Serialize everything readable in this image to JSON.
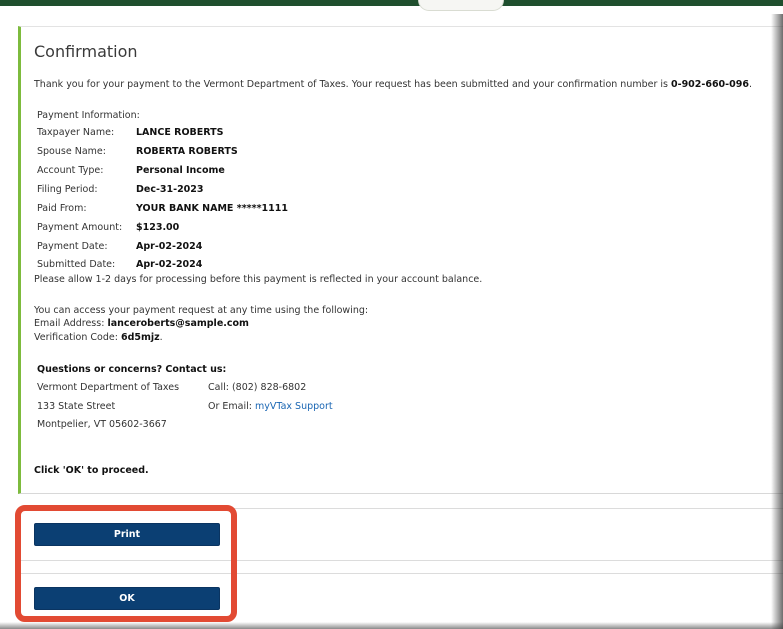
{
  "header": {
    "title": "Confirmation"
  },
  "message": {
    "intro": "Thank you for your payment to the Vermont Department of Taxes. Your request has been submitted and your confirmation number is ",
    "confirmation_number": "0-902-660-096",
    "period": "."
  },
  "payment": {
    "heading": "Payment Information:",
    "rows": [
      {
        "label": "Taxpayer Name:",
        "value": "LANCE ROBERTS"
      },
      {
        "label": "Spouse Name:",
        "value": "ROBERTA ROBERTS"
      },
      {
        "label": "Account Type:",
        "value": "Personal Income"
      },
      {
        "label": "Filing Period:",
        "value": "Dec-31-2023"
      },
      {
        "label": "Paid From:",
        "value": "YOUR BANK NAME *****1111"
      },
      {
        "label": "Payment Amount:",
        "value": "$123.00"
      },
      {
        "label": "Payment Date:",
        "value": "Apr-02-2024"
      },
      {
        "label": "Submitted Date:",
        "value": "Apr-02-2024"
      }
    ]
  },
  "notice": "Please allow 1-2 days for processing before this payment is reflected in your account balance.",
  "access": {
    "line": "You can access your payment request at any time using the following:",
    "email_label": "Email Address:",
    "email_value": "lanceroberts@sample.com",
    "code_label": "Verification Code:",
    "code_value": "6d5mjz",
    "code_period": "."
  },
  "contact": {
    "heading": "Questions or concerns? Contact us:",
    "org": "Vermont Department of Taxes",
    "street": "133 State Street",
    "city": "Montpelier, VT 05602-3667",
    "call": "Call: (802) 828-6802",
    "email_prefix": "Or Email: ",
    "email_link": "myVTax Support"
  },
  "proceed": "Click 'OK' to proceed.",
  "buttons": {
    "print": "Print",
    "ok": "OK"
  },
  "colors": {
    "top_bar": "#1f4f2e",
    "card_accent": "#7dbb3d",
    "button": "#0b3f73",
    "highlight": "#e24a33",
    "link": "#1a66b3"
  }
}
